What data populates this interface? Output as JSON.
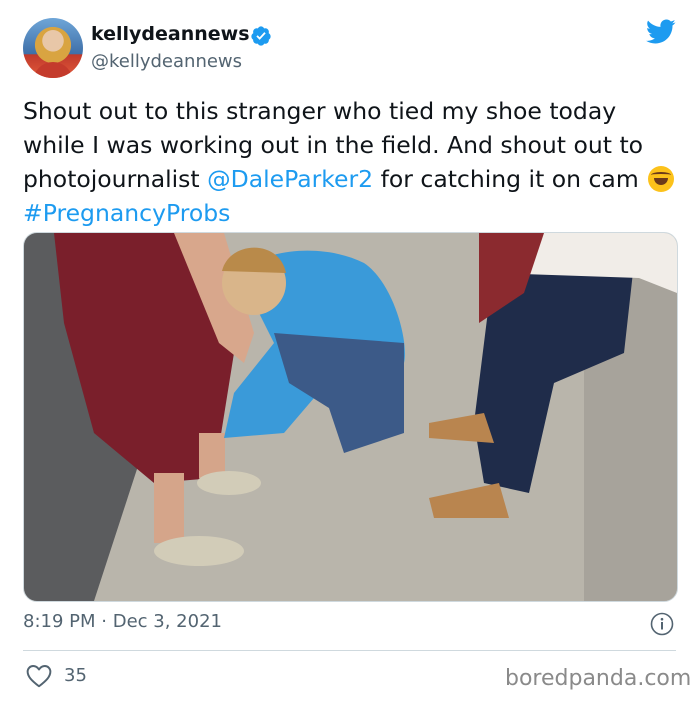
{
  "author": {
    "display_name": "kellydeannews",
    "handle": "@kellydeannews",
    "verified": true
  },
  "icons": {
    "brand": "twitter-bird-icon",
    "verified": "verified-badge-icon",
    "info": "info-icon",
    "like": "heart-icon"
  },
  "colors": {
    "link": "#1d9bf0",
    "verified_badge": "#1d9bf0",
    "secondary_text": "#536471"
  },
  "tweet": {
    "text_part1": "Shout out to this stranger who tied my shoe today while I was working out in the field. And shout out to photojournalist ",
    "mention": "@DaleParker2",
    "text_part2": " for catching it on cam ",
    "emoji": "🤣",
    "hashtag": "#PregnancyProbs"
  },
  "timestamp": {
    "time": "8:19 PM",
    "separator": "·",
    "date": "Dec 3, 2021"
  },
  "engagement": {
    "likes": "35"
  },
  "watermark": "boredpanda.com"
}
